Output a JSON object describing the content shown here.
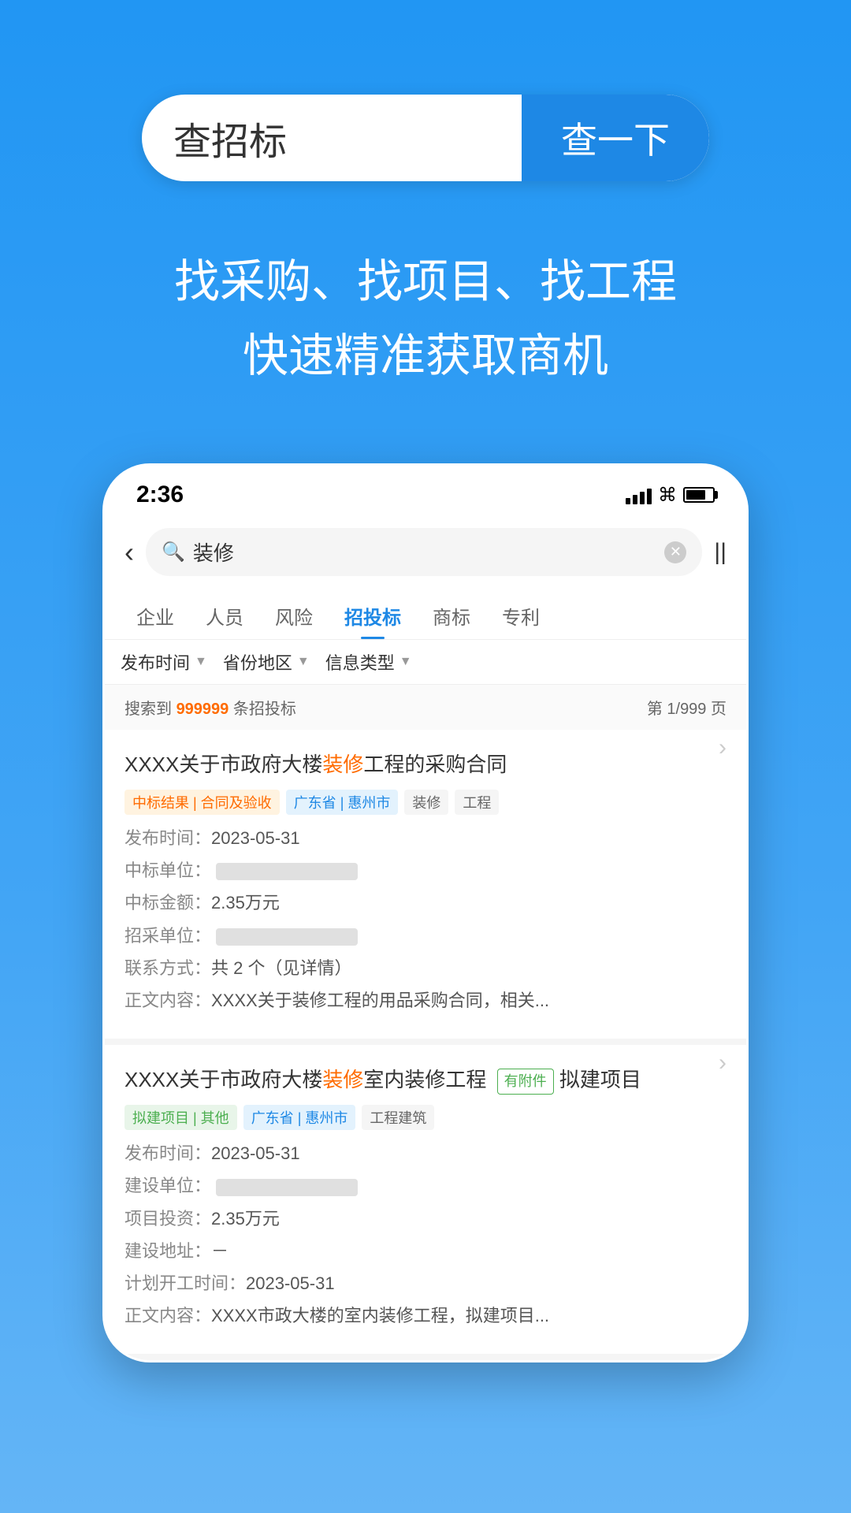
{
  "background": "#2196F3",
  "searchBar": {
    "inputText": "查招标",
    "buttonLabel": "查一下"
  },
  "tagline": {
    "line1": "找采购、找项目、找工程",
    "line2": "快速精准获取商机"
  },
  "phone": {
    "statusBar": {
      "time": "2:36",
      "signal": "full",
      "wifi": true,
      "battery": "full"
    },
    "searchInput": {
      "placeholder": "装修",
      "currentValue": "装修"
    },
    "tabs": [
      {
        "label": "企业",
        "active": false
      },
      {
        "label": "人员",
        "active": false
      },
      {
        "label": "风险",
        "active": false
      },
      {
        "label": "招投标",
        "active": true
      },
      {
        "label": "商标",
        "active": false
      },
      {
        "label": "专利",
        "active": false
      }
    ],
    "filters": [
      {
        "label": "发布时间"
      },
      {
        "label": "省份地区"
      },
      {
        "label": "信息类型"
      }
    ],
    "resultsInfo": {
      "prefix": "搜索到 ",
      "count": "999999",
      "suffix": " 条招投标",
      "page": "第 1/999 页"
    },
    "cards": [
      {
        "title": "XXXX关于市政府大楼装修工程的采购合同",
        "highlightWord": "装修",
        "tags": [
          {
            "text": "中标结果 | 合同及验收",
            "type": "orange"
          },
          {
            "text": "广东省 | 惠州市",
            "type": "blue"
          },
          {
            "text": "装修",
            "type": "gray"
          },
          {
            "text": "工程",
            "type": "gray"
          }
        ],
        "details": [
          {
            "label": "发布时间：",
            "value": "2023-05-31"
          },
          {
            "label": "中标单位：",
            "value": "blurred",
            "blurred": true
          },
          {
            "label": "中标金额：",
            "value": "2.35万元"
          },
          {
            "label": "招采单位：",
            "value": "blurred",
            "blurred": true
          },
          {
            "label": "联系方式：",
            "value": "共 2 个（见详情）"
          },
          {
            "label": "正文内容：",
            "value": "XXXX关于装修工程的用品采购合同，相关..."
          }
        ],
        "hasAttachment": false
      },
      {
        "title": "XXXX关于市政府大楼装修室内装修工程拟建项目",
        "highlightWord": "装修",
        "hasAttachment": true,
        "attachmentLabel": "有附件",
        "tags": [
          {
            "text": "拟建项目 | 其他",
            "type": "green"
          },
          {
            "text": "广东省 | 惠州市",
            "type": "blue"
          },
          {
            "text": "工程建筑",
            "type": "gray"
          }
        ],
        "details": [
          {
            "label": "发布时间：",
            "value": "2023-05-31"
          },
          {
            "label": "建设单位：",
            "value": "blurred",
            "blurred": true
          },
          {
            "label": "项目投资：",
            "value": "2.35万元"
          },
          {
            "label": "建设地址：",
            "value": "－"
          },
          {
            "label": "计划开工时间：",
            "value": "2023-05-31"
          },
          {
            "label": "正文内容：",
            "value": "XXXX市政大楼的室内装修工程，拟建项目..."
          }
        ]
      }
    ]
  }
}
